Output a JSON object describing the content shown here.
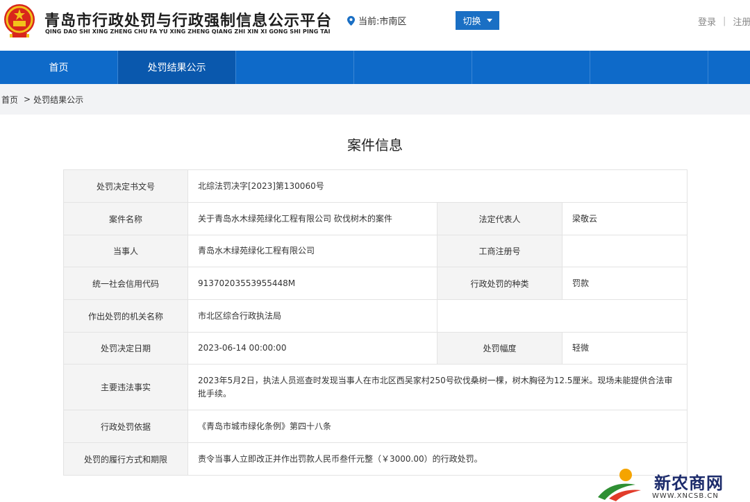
{
  "header": {
    "site_title": "青岛市行政处罚与行政强制信息公示平台",
    "site_subtitle": "QING DAO SHI XING ZHENG CHU FA YU XING ZHENG QIANG ZHI XIN XI GONG SHI PING TAI",
    "location_label": "当前:市南区",
    "switch_label": "切换",
    "login_label": "登录",
    "register_label": "注册",
    "separator": "|"
  },
  "nav": {
    "items": [
      {
        "label": "首页"
      },
      {
        "label": "处罚结果公示"
      }
    ]
  },
  "breadcrumb": {
    "home": "首页",
    "arrow": ">",
    "current": "处罚结果公示"
  },
  "case": {
    "title": "案件信息",
    "decision_no_label": "处罚决定书文号",
    "decision_no": "北综法罚决字[2023]第130060号",
    "case_name_label": "案件名称",
    "case_name": "关于青岛水木绿苑绿化工程有限公司 砍伐树木的案件",
    "legal_rep_label": "法定代表人",
    "legal_rep": "梁敬云",
    "party_label": "当事人",
    "party": "青岛水木绿苑绿化工程有限公司",
    "biz_reg_label": "工商注册号",
    "biz_reg": "",
    "credit_code_label": "统一社会信用代码",
    "credit_code": "91370203553955448M",
    "penalty_type_label": "行政处罚的种类",
    "penalty_type": "罚款",
    "authority_label": "作出处罚的机关名称",
    "authority": "市北区综合行政执法局",
    "decision_date_label": "处罚决定日期",
    "decision_date": "2023-06-14 00:00:00",
    "penalty_range_label": "处罚幅度",
    "penalty_range": "轻微",
    "facts_label": "主要违法事实",
    "facts": "2023年5月2日，执法人员巡查时发现当事人在市北区西吴家村250号砍伐桑树一棵，树木胸径为12.5厘米。现场未能提供合法审批手续。",
    "basis_label": "行政处罚依据",
    "basis": "《青岛市城市绿化条例》第四十八条",
    "execution_label": "处罚的履行方式和期限",
    "execution": "责令当事人立即改正并作出罚款人民币叁仟元整（￥3000.00）的行政处罚。"
  },
  "watermark": {
    "brand": "新农商网",
    "url": "WWW.XNCSB.CN"
  },
  "colors": {
    "nav_bg": "#0e6ac9",
    "nav_active": "#0a58ad",
    "button_bg": "#1a6fc4",
    "label_bg": "#f4f4f4"
  },
  "icons": {
    "emblem": "national-emblem-icon",
    "location": "location-pin-icon",
    "dropdown": "caret-down-icon",
    "watermark_logo": "xncsb-logo-icon"
  }
}
